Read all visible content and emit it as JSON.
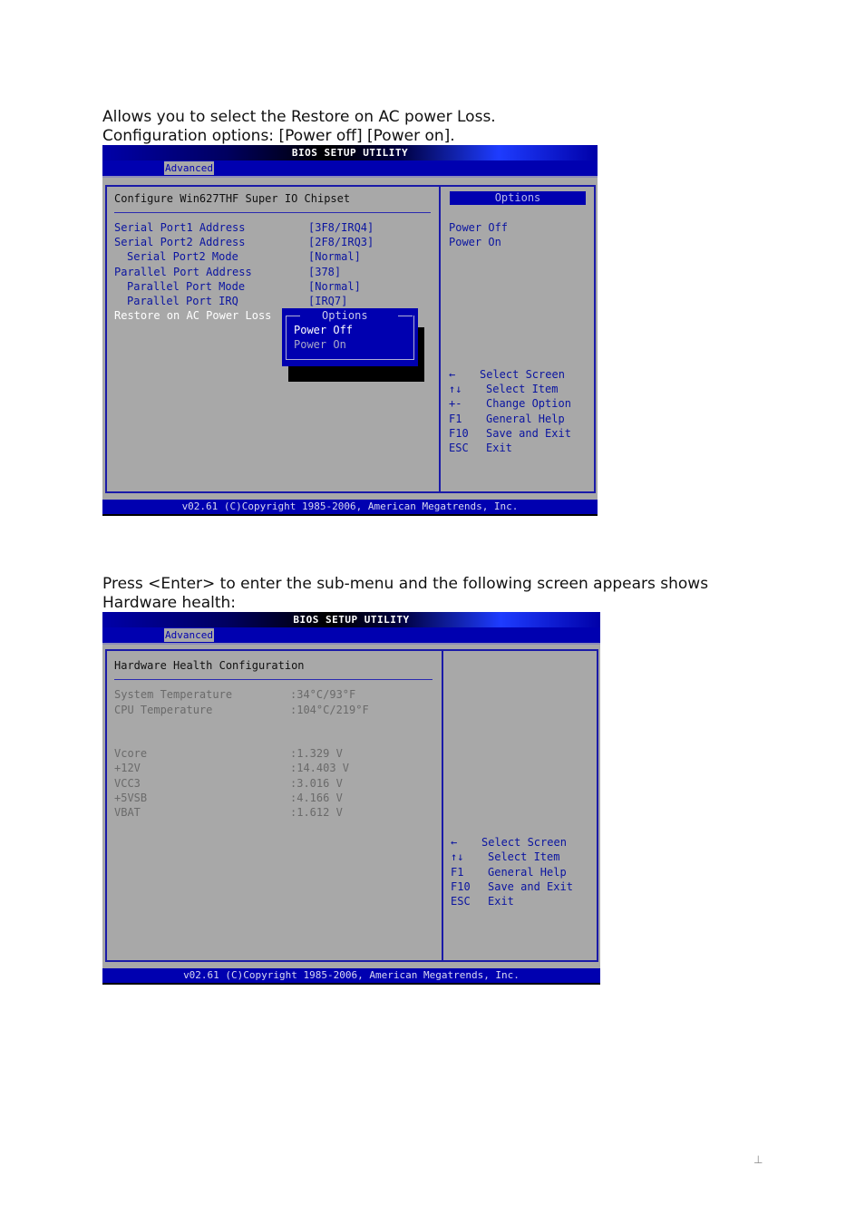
{
  "section1": {
    "intro_line1": "Allows you to select the Restore on AC power Loss.",
    "intro_line2": "Configuration options: [Power off] [Power on].",
    "bios": {
      "title": "BIOS SETUP UTILITY",
      "active_tab": "Advanced",
      "panel_title": "Configure Win627THF Super IO Chipset",
      "settings": [
        {
          "label": "Serial Port1 Address",
          "value": "[3F8/IRQ4]",
          "indent": false
        },
        {
          "label": "Serial Port2 Address",
          "value": "[2F8/IRQ3]",
          "indent": false
        },
        {
          "label": "Serial Port2 Mode",
          "value": "[Normal]",
          "indent": true
        },
        {
          "label": "Parallel Port Address",
          "value": "[378]",
          "indent": false
        },
        {
          "label": "Parallel Port Mode",
          "value": "[Normal]",
          "indent": true
        },
        {
          "label": "Parallel Port IRQ",
          "value": "[IRQ7]",
          "indent": true
        },
        {
          "label": "Restore on AC Power Loss",
          "value": "",
          "indent": false,
          "selected": true
        }
      ],
      "popup": {
        "title": "Options",
        "options": [
          {
            "label": "Power Off",
            "highlighted": true
          },
          {
            "label": "Power On",
            "highlighted": false
          }
        ]
      },
      "help": {
        "header": "Options",
        "items": [
          "Power Off",
          "Power On"
        ]
      },
      "keys": [
        {
          "key": "←",
          "action": "Select Screen"
        },
        {
          "key": "↑↓",
          "action": "Select Item"
        },
        {
          "key": "+-",
          "action": "Change Option"
        },
        {
          "key": "F1",
          "action": "General Help"
        },
        {
          "key": "F10",
          "action": "Save and Exit"
        },
        {
          "key": "ESC",
          "action": "Exit"
        }
      ],
      "footer": "v02.61 (C)Copyright 1985-2006, American Megatrends, Inc."
    }
  },
  "section2": {
    "intro_line1": "Press <Enter> to enter the sub-menu and the following screen appears shows",
    "intro_line2": "Hardware health:",
    "bios": {
      "title": "BIOS SETUP UTILITY",
      "active_tab": "Advanced",
      "panel_title": "Hardware Health Configuration",
      "temperatures": [
        {
          "label": "System Temperature",
          "value": ":34°C/93°F"
        },
        {
          "label": "CPU Temperature",
          "value": ":104°C/219°F"
        }
      ],
      "voltages": [
        {
          "label": "Vcore",
          "value": ":1.329 V"
        },
        {
          "label": "+12V",
          "value": ":14.403 V"
        },
        {
          "label": "VCC3",
          "value": ":3.016 V"
        },
        {
          "label": "+5VSB",
          "value": ":4.166 V"
        },
        {
          "label": "VBAT",
          "value": ":1.612 V"
        }
      ],
      "keys": [
        {
          "key": "←",
          "action": "Select Screen"
        },
        {
          "key": "↑↓",
          "action": "Select Item"
        },
        {
          "key": "F1",
          "action": "General Help"
        },
        {
          "key": "F10",
          "action": "Save and Exit"
        },
        {
          "key": "ESC",
          "action": "Exit"
        }
      ],
      "footer": "v02.61 (C)Copyright 1985-2006, American Megatrends, Inc."
    }
  },
  "page_marker": "⊥"
}
